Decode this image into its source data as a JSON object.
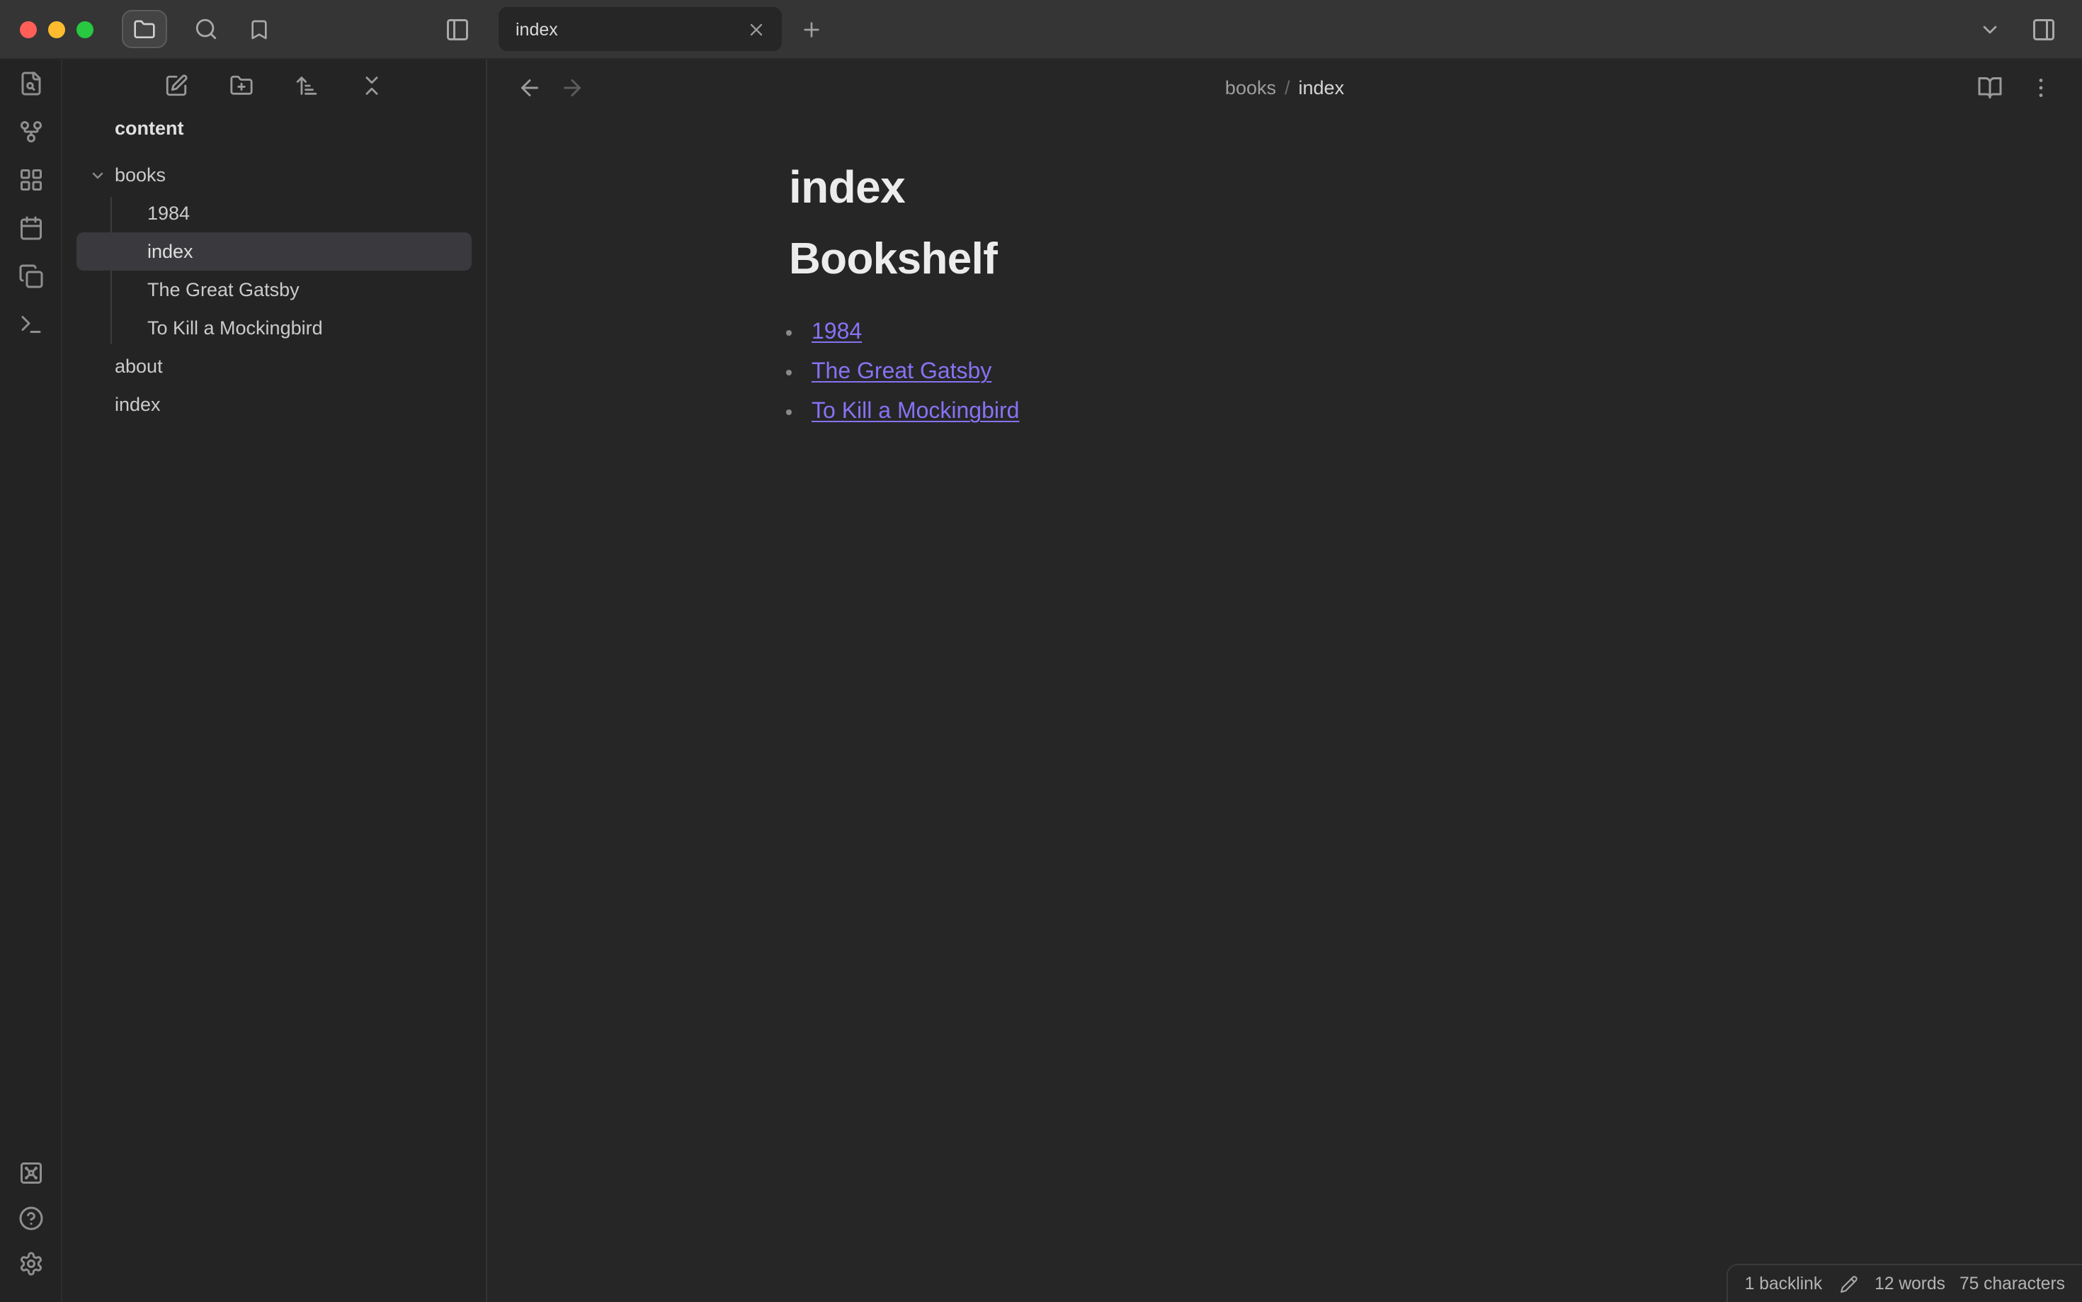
{
  "colors": {
    "accent": "#8673f4",
    "tab_red": "#ff5f57",
    "tab_yellow": "#febc2e",
    "tab_green": "#28c840"
  },
  "titlebar": {
    "tab": {
      "label": "index"
    },
    "new_tab_label": "+"
  },
  "icons": {
    "titlebar": [
      "folder-icon",
      "search-icon",
      "bookmark-icon",
      "panel-left-icon",
      "chevron-down-icon",
      "panel-right-icon"
    ],
    "ribbon_top": [
      "file-search-icon",
      "graph-icon",
      "layout-grid-icon",
      "calendar-icon",
      "copy-icon",
      "terminal-icon"
    ],
    "ribbon_bottom": [
      "vault-icon",
      "help-icon",
      "settings-icon"
    ],
    "explorer_toolbar": [
      "new-note-icon",
      "new-folder-icon",
      "sort-icon",
      "collapse-all-icon"
    ],
    "view_header": [
      "arrow-left-icon",
      "arrow-right-icon",
      "book-open-icon",
      "more-vertical-icon"
    ],
    "status": [
      "pencil-icon"
    ]
  },
  "sidebar": {
    "vault_name": "content",
    "tree": [
      {
        "label": "books",
        "type": "folder",
        "expanded": true
      },
      {
        "label": "1984",
        "type": "file"
      },
      {
        "label": "index",
        "type": "file",
        "selected": true
      },
      {
        "label": "The Great Gatsby",
        "type": "file"
      },
      {
        "label": "To Kill a Mockingbird",
        "type": "file"
      },
      {
        "label": "about",
        "type": "file"
      },
      {
        "label": "index",
        "type": "file"
      }
    ]
  },
  "editor": {
    "breadcrumb": {
      "parent": "books",
      "separator": "/",
      "current": "index"
    },
    "note_title": "index",
    "heading": "Bookshelf",
    "links": [
      "1984",
      "The Great Gatsby",
      "To Kill a Mockingbird"
    ]
  },
  "status_bar": {
    "backlinks": "1 backlink",
    "words": "12 words",
    "characters": "75 characters"
  }
}
